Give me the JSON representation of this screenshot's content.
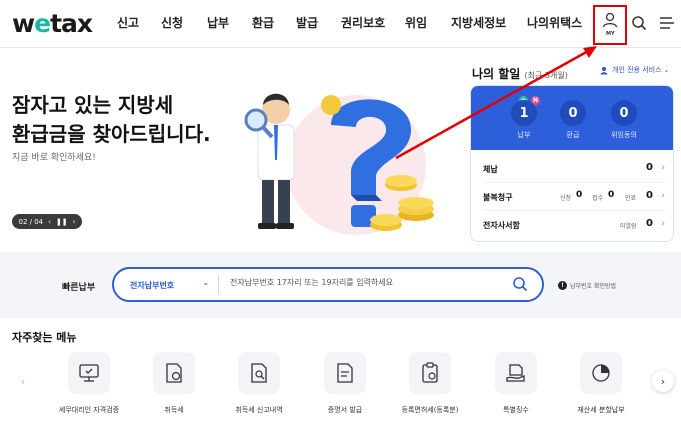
{
  "header": {
    "logo_prefix": "w",
    "logo_e": "e",
    "logo_suffix": "tax",
    "nav": [
      "신고",
      "신청",
      "납부",
      "환급",
      "발급",
      "권리보호",
      "위임",
      "지방세정보",
      "나의위택스"
    ],
    "my_label": "MY"
  },
  "hero": {
    "title": "잠자고 있는 지방세\n환급금을 찾아드립니다.",
    "subtitle": "지금 바로 확인하세요!",
    "slide_counter": "02 / 04"
  },
  "panel": {
    "title": "나의 할일",
    "title_small": "(최근 3개월)",
    "personal_service": "개인 전용 서비스",
    "stats": [
      {
        "value": "1",
        "label": "납부"
      },
      {
        "value": "0",
        "label": "환급"
      },
      {
        "value": "0",
        "label": "위임동의"
      }
    ],
    "badges": [
      "+",
      "N"
    ],
    "rows": [
      {
        "label": "체납",
        "value": "0"
      },
      {
        "label": "불복청구",
        "sub1_label": "신청",
        "sub1_value": "0",
        "sub2_label": "접수",
        "sub2_value": "0",
        "sub3_label": "안료",
        "value": "0"
      },
      {
        "label": "전자사서함",
        "sub1_label": "미열람",
        "value": "0"
      }
    ]
  },
  "quick_pay": {
    "label": "빠른납부",
    "select_value": "전자납부번호",
    "placeholder": "전자납부번호 17자리 또는 19자리를 입력하세요",
    "info": "납부번호 확인방법"
  },
  "frequent": {
    "title": "자주찾는 메뉴",
    "items": [
      "세무대리인 자격검증",
      "취득세",
      "취득세 신고내역",
      "증명서 발급",
      "등록면허세(등록분)",
      "특별징수",
      "재산세 분할납부"
    ]
  },
  "colors": {
    "brand": "#2c5fd9",
    "accent_green": "#1db5a4",
    "annotation_red": "#e00000"
  }
}
